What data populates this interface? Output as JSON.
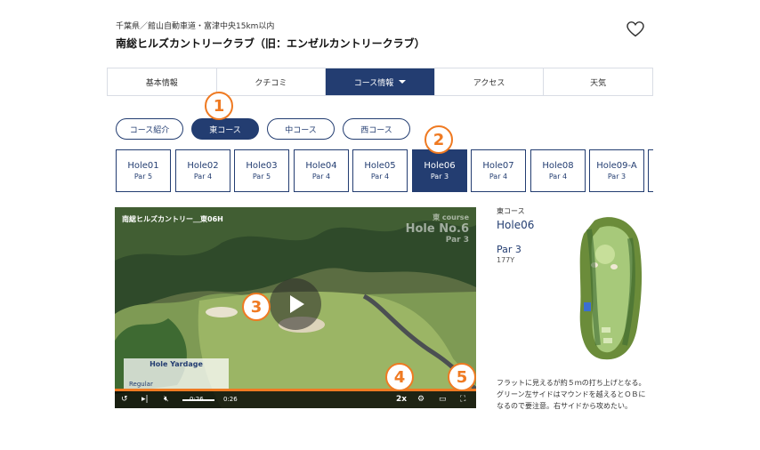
{
  "header": {
    "region": "千葉県／館山自動車道・富津中央15km以内",
    "title": "南総ヒルズカントリークラブ（旧：エンゼルカントリークラブ）",
    "favorite_icon": "heart-icon"
  },
  "tabs": [
    {
      "label": "基本情報",
      "active": false
    },
    {
      "label": "クチコミ",
      "active": false
    },
    {
      "label": "コース情報",
      "active": true
    },
    {
      "label": "アクセス",
      "active": false
    },
    {
      "label": "天気",
      "active": false
    }
  ],
  "courses": [
    {
      "label": "コース紹介",
      "active": false
    },
    {
      "label": "東コース",
      "active": true
    },
    {
      "label": "中コース",
      "active": false
    },
    {
      "label": "西コース",
      "active": false
    }
  ],
  "holes": [
    {
      "name": "Hole01",
      "par": "Par 5",
      "active": false
    },
    {
      "name": "Hole02",
      "par": "Par 4",
      "active": false
    },
    {
      "name": "Hole03",
      "par": "Par 5",
      "active": false
    },
    {
      "name": "Hole04",
      "par": "Par 4",
      "active": false
    },
    {
      "name": "Hole05",
      "par": "Par 4",
      "active": false
    },
    {
      "name": "Hole06",
      "par": "Par 3",
      "active": true
    },
    {
      "name": "Hole07",
      "par": "Par 4",
      "active": false
    },
    {
      "name": "Hole08",
      "par": "Par 4",
      "active": false
    },
    {
      "name": "Hole09-A",
      "par": "Par 3",
      "active": false
    }
  ],
  "badges": [
    "1",
    "2",
    "3",
    "4",
    "5"
  ],
  "video": {
    "title": "南総ヒルズカントリー＿東06H",
    "watermark_course": "東 course",
    "watermark_hole": "Hole No.6",
    "watermark_par": "Par 3",
    "yardage_title": "Hole Yardage",
    "yardage_row": "Regular",
    "time_current": "0:26",
    "time_total": "0:26",
    "speed": "2x",
    "progress": 1.0
  },
  "side": {
    "course": "東コース",
    "hole": "Hole06",
    "par": "Par 3",
    "yards": "177Y",
    "description": "フラットに見えるが約５ｍの打ち上げとなる。グリーン左サイドはマウンドを越えるとＯＢになるので要注意。右サイドから攻めたい。"
  },
  "colors": {
    "navy": "#233d71",
    "orange": "#ef7a22"
  }
}
